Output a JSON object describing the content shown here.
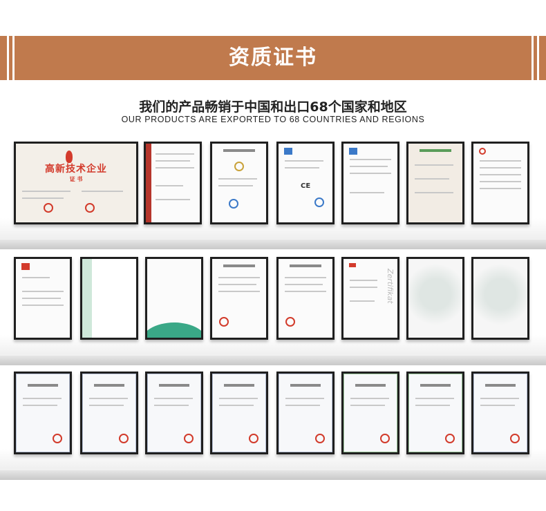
{
  "banner": {
    "title": "资质证书",
    "color": "#c07a4d"
  },
  "headline": "我们的产品畅销于中国和出口68个国家和地区",
  "subline": "OUR PRODUCTS ARE EXPORTED TO 68 COUNTRIES AND REGIONS",
  "award": {
    "title": "高新技术企业",
    "subtitle": "证 书"
  },
  "eco": {
    "watermark": "Zertifikat"
  },
  "ce": {
    "mark": "CE"
  }
}
